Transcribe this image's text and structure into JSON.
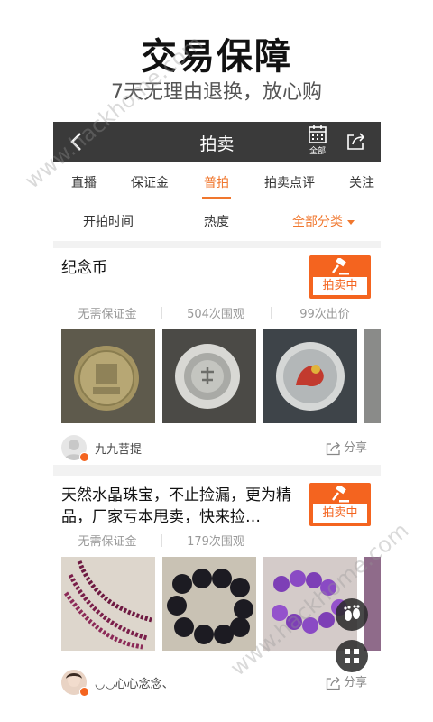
{
  "promo": {
    "title": "交易保障",
    "subtitle": "7天无理由退换，放心购"
  },
  "topbar": {
    "title": "拍卖",
    "calendar_label": "全部"
  },
  "tabs": [
    {
      "label": "直播",
      "active": false
    },
    {
      "label": "保证金",
      "active": false
    },
    {
      "label": "普拍",
      "active": true
    },
    {
      "label": "拍卖点评",
      "active": false
    },
    {
      "label": "关注",
      "active": false
    }
  ],
  "filters": [
    {
      "label": "开拍时间",
      "active": false
    },
    {
      "label": "热度",
      "active": false
    },
    {
      "label": "全部分类",
      "active": true
    }
  ],
  "listings": [
    {
      "title": "纪念币",
      "badge": "拍卖中",
      "stats": [
        "无需保证金",
        "504次围观",
        "99次出价"
      ],
      "seller": "九九菩提",
      "share": "分享"
    },
    {
      "title": "天然水晶珠宝，不止捡漏，更为精品，厂家亏本甩卖，快来捡…",
      "badge": "拍卖中",
      "stats": [
        "无需保证金",
        "179次围观"
      ],
      "seller": "◡◡心心念念、",
      "share": "分享"
    }
  ],
  "watermarks": [
    "www.hackhome.com",
    "www.hackhome.com"
  ],
  "colors": {
    "accent": "#f0772e",
    "badge": "#f4641f",
    "topbar": "#3a3a3a"
  }
}
